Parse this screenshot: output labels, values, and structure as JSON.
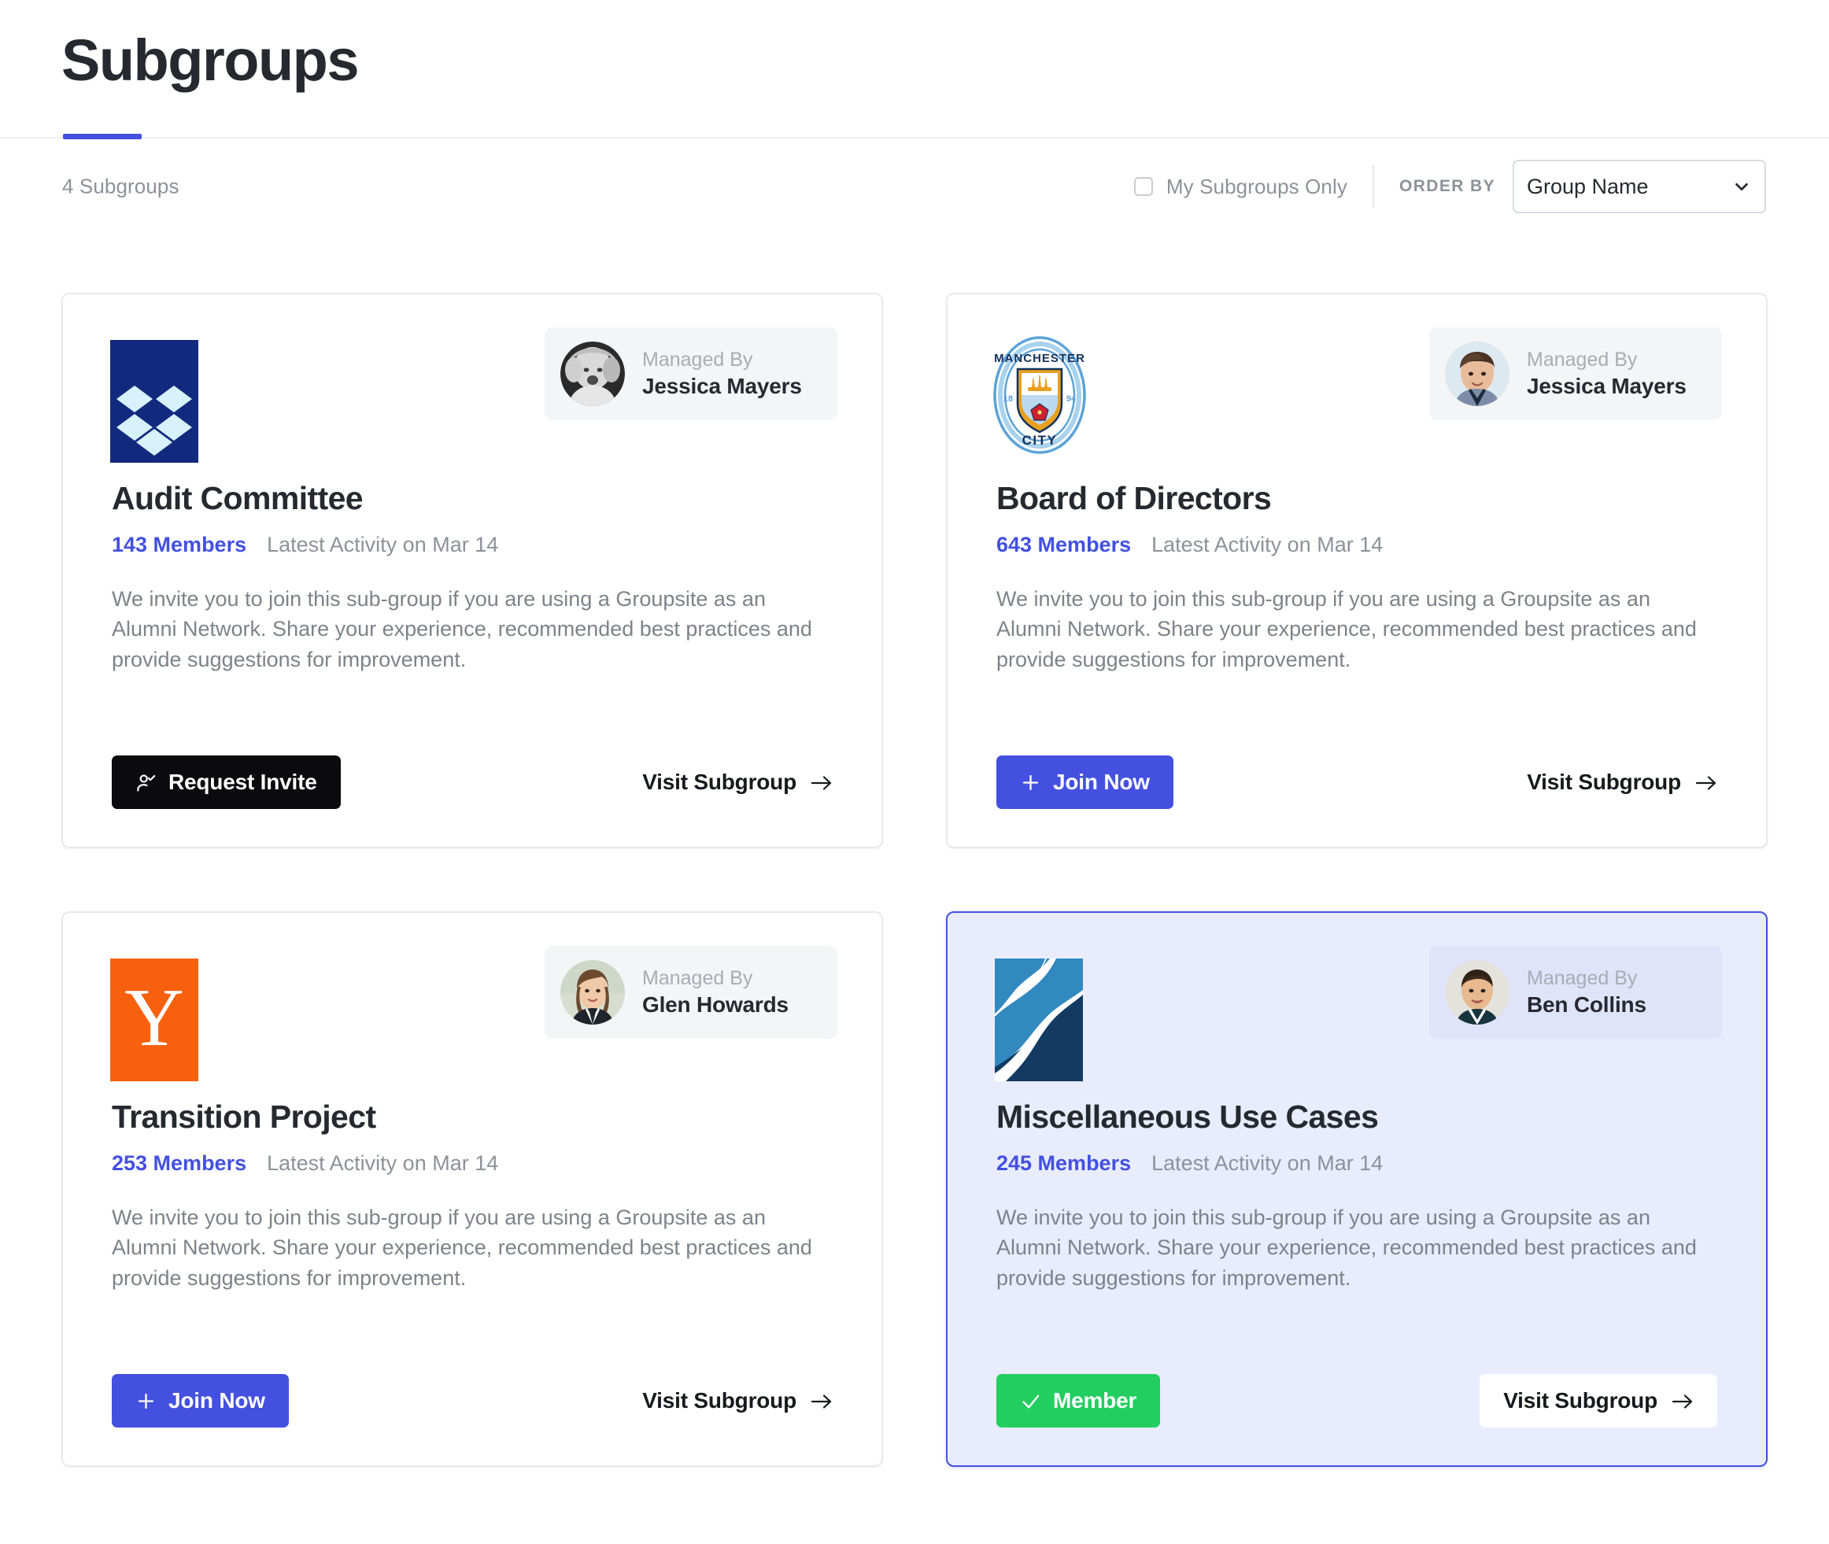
{
  "header": {
    "title": "Subgroups"
  },
  "toolbar": {
    "count_label": "4 Subgroups",
    "my_subgroups_only_label": "My Subgroups Only",
    "my_subgroups_only_checked": false,
    "order_by_label": "ORDER BY",
    "order_by_value": "Group Name",
    "order_by_options": [
      "Group Name"
    ]
  },
  "colors": {
    "accent": "#4350e0",
    "member_green": "#23ce60",
    "request_dark": "#0b0b0d",
    "selected_card_bg": "#e9ecfd",
    "muted_text": "#8d9199"
  },
  "cards": [
    {
      "logo": "dropbox-logo",
      "managed_by_label": "Managed By",
      "manager_name": "Jessica Mayers",
      "avatar": "avatar-blonde-woman",
      "title": "Audit Committee",
      "members": "143 Members",
      "activity": "Latest Activity on Mar 14",
      "description": "We invite you to join this sub-group if you are using a Groupsite as an Alumni Network. Share your experience, recommended best practices and provide suggestions for improvement.",
      "primary_action_label": "Request Invite",
      "primary_action_icon": "person-check-icon",
      "primary_action_style": "dark",
      "visit_label": "Visit Subgroup",
      "visit_icon": "arrow-right-icon",
      "selected": false
    },
    {
      "logo": "manchester-city-crest",
      "managed_by_label": "Managed By",
      "manager_name": "Jessica Mayers",
      "avatar": "avatar-short-hair-woman",
      "title": "Board of Directors",
      "members": "643 Members",
      "activity": "Latest Activity on Mar 14",
      "description": "We invite you to join this sub-group if you are using a Groupsite as an Alumni Network. Share your experience, recommended best practices and provide suggestions for improvement.",
      "primary_action_label": "Join Now",
      "primary_action_icon": "plus-icon",
      "primary_action_style": "blue",
      "visit_label": "Visit Subgroup",
      "visit_icon": "arrow-right-icon",
      "selected": false
    },
    {
      "logo": "y-combinator-logo",
      "logo_letter": "Y",
      "managed_by_label": "Managed By",
      "manager_name": "Glen Howards",
      "avatar": "avatar-suited-woman",
      "title": "Transition Project",
      "members": "253 Members",
      "activity": "Latest Activity on Mar 14",
      "description": "We invite you to join this sub-group if you are using a Groupsite as an Alumni Network. Share your experience, recommended best practices and provide suggestions for improvement.",
      "primary_action_label": "Join Now",
      "primary_action_icon": "plus-icon",
      "primary_action_style": "blue",
      "visit_label": "Visit Subgroup",
      "visit_icon": "arrow-right-icon",
      "selected": false
    },
    {
      "logo": "abstract-blue-logo",
      "managed_by_label": "Managed By",
      "manager_name": "Ben Collins",
      "avatar": "avatar-suited-man",
      "title": "Miscellaneous Use Cases",
      "members": "245 Members",
      "activity": "Latest Activity on Mar 14",
      "description": "We invite you to join this sub-group if you are using a Groupsite as an Alumni Network. Share your experience, recommended best practices and provide suggestions for improvement.",
      "primary_action_label": "Member",
      "primary_action_icon": "check-icon",
      "primary_action_style": "green",
      "visit_label": "Visit Subgroup",
      "visit_icon": "arrow-right-icon",
      "selected": true
    }
  ]
}
